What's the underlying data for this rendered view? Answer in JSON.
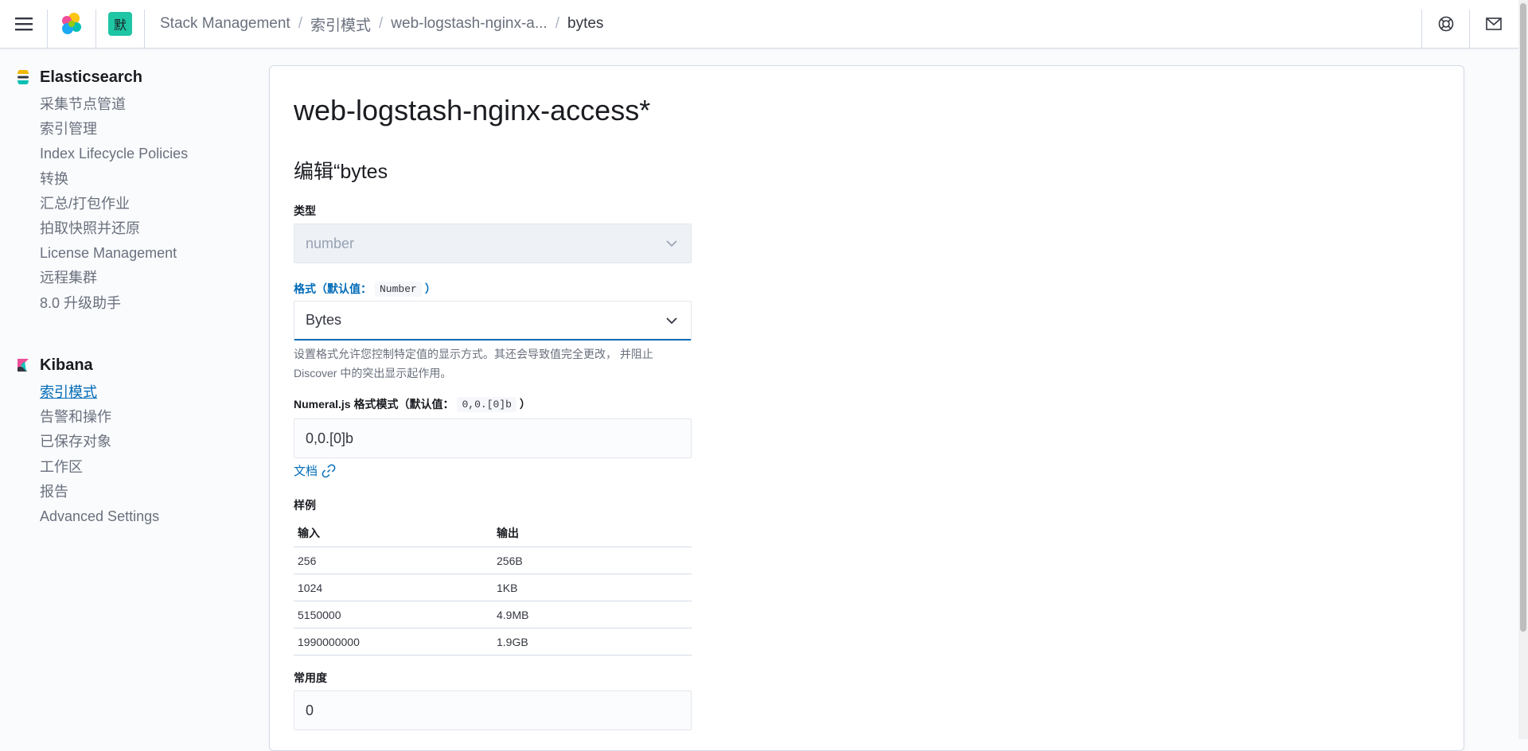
{
  "header": {
    "space_initial": "默",
    "breadcrumbs": [
      "Stack Management",
      "索引模式",
      "web-logstash-nginx-a...",
      "bytes"
    ]
  },
  "sidebar": {
    "elasticsearch": {
      "title": "Elasticsearch",
      "items": [
        "采集节点管道",
        "索引管理",
        "Index Lifecycle Policies",
        "转换",
        "汇总/打包作业",
        "拍取快照并还原",
        "License Management",
        "远程集群",
        "8.0 升级助手"
      ]
    },
    "kibana": {
      "title": "Kibana",
      "items": [
        "索引模式",
        "告警和操作",
        "已保存对象",
        "工作区",
        "报告",
        "Advanced Settings"
      ],
      "active_item": "索引模式"
    }
  },
  "main": {
    "page_title": "web-logstash-nginx-access*",
    "section_title": "编辑“bytes",
    "type": {
      "label": "类型",
      "value": "number"
    },
    "format": {
      "label": "格式（默认值：",
      "default_value": "Number",
      "label_end": "）",
      "value": "Bytes",
      "help": "设置格式允许您控制特定值的显示方式。其还会导致值完全更改，   并阻止 Discover 中的突出显示起作用。"
    },
    "numeral": {
      "label": "Numeral.js 格式模式（默认值：",
      "default_value": "0,0.[0]b",
      "label_end": "）",
      "value": "0,0.[0]b"
    },
    "doc_link": "文档",
    "samples": {
      "title": "样例",
      "columns": [
        "输入",
        "输出"
      ],
      "rows": [
        [
          "256",
          "256B"
        ],
        [
          "1024",
          "1KB"
        ],
        [
          "5150000",
          "4.9MB"
        ],
        [
          "1990000000",
          "1.9GB"
        ]
      ]
    },
    "popularity": {
      "label": "常用度",
      "value": "0"
    }
  },
  "colors": {
    "accent": "#006bb8",
    "space_badge": "#1ec6a4",
    "text": "#343741",
    "muted": "#69707d"
  }
}
